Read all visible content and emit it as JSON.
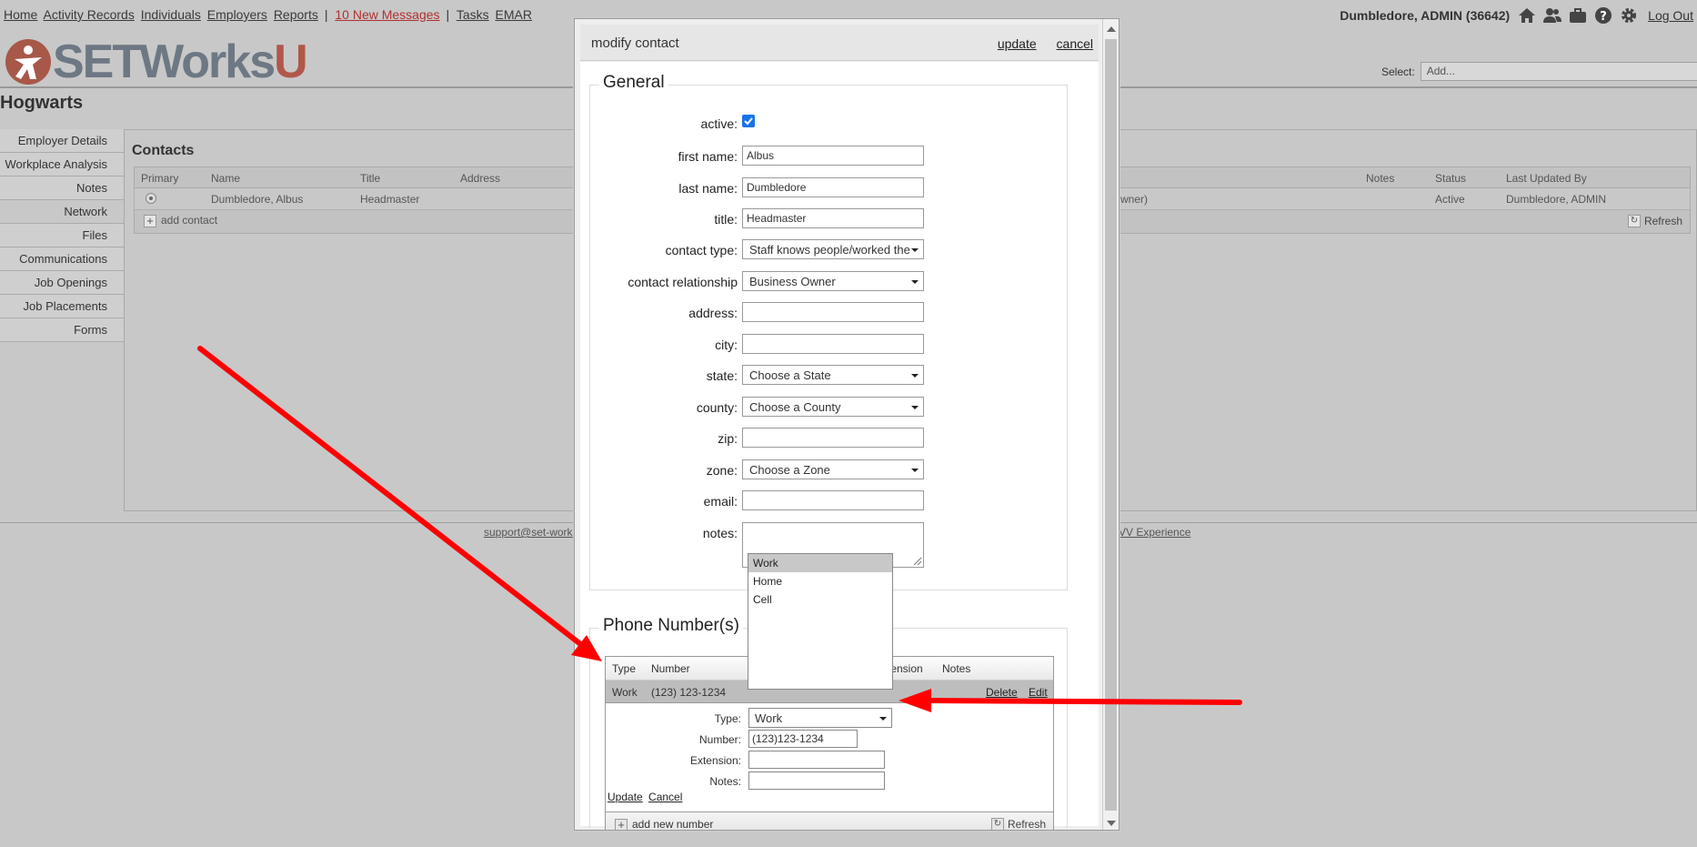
{
  "topnav": {
    "links": [
      "Home",
      "Activity Records",
      "Individuals",
      "Employers",
      "Reports"
    ],
    "messages": "10 New Messages",
    "links2": [
      "Tasks",
      "EMAR"
    ]
  },
  "user": {
    "name": "Dumbledore, ADMIN (36642)",
    "logout": "Log Out",
    "icons": [
      "home-icon",
      "users-icon",
      "briefcase-icon",
      "help-icon",
      "gear-icon"
    ]
  },
  "logo": {
    "text": "SETWorks",
    "suffix": "U"
  },
  "select": {
    "label": "Select:",
    "value": "Add..."
  },
  "org": {
    "name": "Hogwarts"
  },
  "sidebar": {
    "items": [
      "Employer Details",
      "Workplace Analysis",
      "Notes",
      "Network",
      "Files",
      "Communications",
      "Job Openings",
      "Job Placements",
      "Forms"
    ]
  },
  "contacts": {
    "title": "Contacts",
    "columns": {
      "primary": "Primary",
      "name": "Name",
      "title": "Title",
      "address": "Address",
      "notes": "Notes",
      "status": "Status",
      "last_updated_by": "Last Updated By"
    },
    "rows": [
      {
        "name": "Dumbledore, Albus",
        "title": "Headmaster",
        "relationship": "wner)",
        "status": "Active",
        "last_updated_by": "Dumbledore, ADMIN"
      }
    ],
    "add_label": "add contact",
    "refresh_label": "Refresh"
  },
  "footer": {
    "left": "support@set-works.c",
    "right": "EVV Experience"
  },
  "modal": {
    "title": "modify contact",
    "update": "update",
    "cancel": "cancel",
    "general": {
      "legend": "General",
      "active_label": "active:",
      "first_name_label": "first name:",
      "first_name": "Albus",
      "last_name_label": "last name:",
      "last_name": "Dumbledore",
      "title_label": "title:",
      "title": "Headmaster",
      "contact_type_label": "contact type:",
      "contact_type": "Staff knows people/worked the",
      "relationship_label": "contact relationship",
      "relationship": "Business Owner",
      "address_label": "address:",
      "city_label": "city:",
      "state_label": "state:",
      "state": "Choose a State",
      "county_label": "county:",
      "county": "Choose a County",
      "zip_label": "zip:",
      "zone_label": "zone:",
      "zone": "Choose a Zone",
      "email_label": "email:",
      "notes_label": "notes:"
    },
    "phones": {
      "legend": "Phone Number(s)",
      "columns": {
        "type": "Type",
        "number": "Number",
        "extension": "tension",
        "notes": "Notes"
      },
      "row": {
        "type": "Work",
        "number": "(123) 123-1234",
        "delete": "Delete",
        "edit": "Edit"
      },
      "edit": {
        "type_label": "Type:",
        "type_value": "Work",
        "number_label": "Number:",
        "number_value": "(123)123-1234",
        "extension_label": "Extension:",
        "notes_label": "Notes:",
        "update": "Update",
        "cancel": "Cancel"
      },
      "add_label": "add new number",
      "refresh_label": "Refresh"
    }
  },
  "dropdown": {
    "options": [
      "Work",
      "Home",
      "Cell"
    ],
    "selected": "Work"
  },
  "colors": {
    "arrow": "#ff0000",
    "overlay": "#c8c8c8",
    "checkbox": "#1a73e8",
    "messages_link": "#b03030"
  }
}
